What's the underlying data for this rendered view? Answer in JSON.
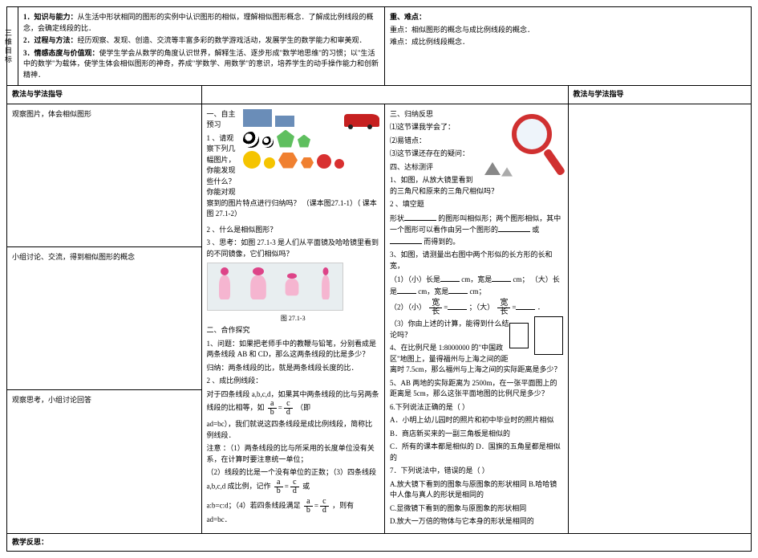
{
  "header": {
    "col_label": "三维目标",
    "item1_label": "1．知识与能力：",
    "item1_text": "从生活中形状相同的图形的实例中认识图形的相似，理解相似图形概念．了解成比例线段的概念，会确定线段的比．",
    "item2_label": "2．过程与方法：",
    "item2_text": "经历观察、发现、创造、交流等丰富多彩的数学游戏活动，发展学生的数学能力和审美观．",
    "item3_label": "3．情感态度与价值观：",
    "item3_text": "使学生学会从数学的角度认识世界，解释生活、逐步形成\"数学地思维\"的习惯；以\"生活中的数学\"为载体，使学生体会相似图形的神奇，养成\"学数学、用数学\"的意识，培养学生的动手操作能力和创新精神．",
    "diff_label": "重、难点：",
    "diff_text1": "重点：相似图形的概念与成比例线段的概念．",
    "diff_text2": "难点：成比例线段概念．"
  },
  "method_header": "教法与学法指导",
  "method_header_right": "教法与学法指导",
  "method": {
    "r1": "观察图片，体会相似图形",
    "r2": "小组讨论、交流，得到相似图形的概念",
    "r3": "观察思考，小组讨论回答"
  },
  "left": {
    "sec1_title": "一、自主预习",
    "q1": "1 、请观察下列几幅图片，你能发现些什么？你能对观察到的图片特点进行归纳吗？  （课本图27.1-1）（ 课本图 27.1-2）",
    "q2": "2 、什么是相似图形？",
    "q3": "3 、思考：如图 27.1-3 是人们从平面镜及哈哈镜里看到的不同镜像，它们相似吗？",
    "fig_caption": "图 27.1-3",
    "sec2_title": "二、合作探究",
    "p1": "1、问题：如果把老师手中的教鞭与铅笔，分别看成是两条线段 AB 和 CD，那么这两条线段的比是多少？",
    "p1b": "归纳：两条线段的比，就是两条线段长度的比．",
    "p2": "2 、成比例线段：",
    "p2a_pre": "对于四条线段 a,b,c,d，如果其中两条线段的比与另两条线段的比相等，如",
    "p2a_post": "（即",
    "p2a_end": "ad=bc），我们就说这四条线段是成比例线段，简称比例线段．",
    "note1": "注意  ：（1）两条线段的比与所采用的长度单位没有关系，在计算时要注意统一单位；",
    "note2": "（2）线段的比是一个没有单位的正数；（3）四条线段 a,b,c,d 成比例，记作",
    "note2b": "或",
    "note3_pre": "a:b=c:d；（4）若四条线段满足",
    "note3_post": "，则有 ad=bc．"
  },
  "right": {
    "sec3_title": "三、归纳反思",
    "r1": "⑴这节课我学会了：",
    "r2": "⑵易错点：",
    "r3": "⑶这节课还存在的疑问：",
    "sec4_title": "四、达标测评",
    "t1": "1、如图，从放大镜里看到的三角尺和原来的三角尺相似吗？",
    "t2": "2 、填空题",
    "t2a_pre": "形状",
    "t2a_mid": "的图形叫相似形；两个图形相似，其中一个图形可以看作由另一个图形的",
    "t2a_mid2": "或",
    "t2a_end": "而得到的。",
    "t3": "3、如图，请测量出右图中两个形似的长方形的长和宽，",
    "t3_1a": "（1）（小）长是",
    "t3_1b": "cm，宽是",
    "t3_1c": "cm； （大）长是",
    "t3_1d": "cm，宽是",
    "t3_1e": "cm；",
    "t3_2a": "（2）（小）",
    "t3_2b": "；（大）",
    "t3_2c": "．",
    "t3_frac_num": "宽",
    "t3_frac_den": "长",
    "t3_3": "（3）你由上述的计算，能得到什么结论吗？",
    "t4": "4、在比例尺是 1:8000000 的\"中国政区\"地图上，量得福州与上海之间的距离时 7.5cm，那么福州与上海之间的实际距离是多少？",
    "t5": "5、AB 两地的实际距离为 2500m，在一张平面图上的距离是 5cm，那么这张平面地图的比例尺是多少？",
    "t6": "6.下列说法正确的是（    ）",
    "t6a": "A．小明上幼儿园时的照片和初中毕业时的照片相似",
    "t6b": "B．商店新买来的一副三角板是相似的",
    "t6c": "C．所有的课本都是相似的   D．国旗的五角星都是相似的",
    "t7": "7．下列说法中，错误的是（    ）",
    "t7a": "A.放大镜下看到的图象与原图象的形状相同   B.哈哈镜中人像与真人的形状是相同的",
    "t7b": "C.显微镜下看到的图象与原图象的形状相同",
    "t7c": "D.放大一万倍的物体与它本身的形状是相同的"
  },
  "reflection_label": "教学反思："
}
